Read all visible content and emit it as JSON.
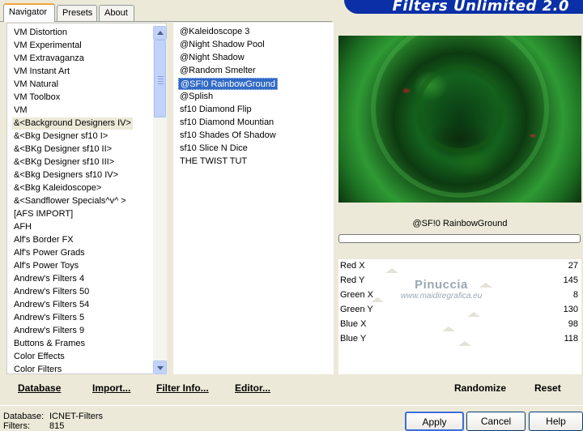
{
  "tabs": [
    {
      "label": "Navigator"
    },
    {
      "label": "Presets"
    },
    {
      "label": "About"
    }
  ],
  "banner": {
    "title": "Filters Unlimited 2.0"
  },
  "category_list": {
    "items": [
      "VM Distortion",
      "VM Experimental",
      "VM Extravaganza",
      "VM Instant Art",
      "VM Natural",
      "VM Toolbox",
      "VM",
      "&<Background Designers IV>",
      "&<Bkg Designer sf10 I>",
      "&<BKg Designer sf10 II>",
      "&<BKg Designer sf10 III>",
      "&<Bkg Designers sf10 IV>",
      "&<Bkg Kaleidoscope>",
      "&<Sandflower Specials^v^ >",
      "[AFS IMPORT]",
      "AFH",
      "Alf's Border FX",
      "Alf's Power Grads",
      "Alf's Power Toys",
      "Andrew's Filters 4",
      "Andrew's Filters 50",
      "Andrew's Filters 54",
      "Andrew's Filters 5",
      "Andrew's Filters 9",
      "Buttons & Frames",
      "Color Effects",
      "Color Filters"
    ],
    "selected": "&<Background Designers IV>"
  },
  "filter_list": {
    "items": [
      "@Kaleidoscope 3",
      "@Night Shadow Pool",
      "@Night Shadow",
      "@Random Smelter",
      "@SF!0 RainbowGround",
      "@Splish",
      "sf10 Diamond Flip",
      "sf10 Diamond Mountian",
      "sf10 Shades Of Shadow",
      "sf10 Slice N Dice",
      "THE TWIST TUT"
    ],
    "selected": "@SF!0 RainbowGround"
  },
  "preview": {
    "filter_name": "@SF!0 RainbowGround"
  },
  "params": [
    {
      "label": "Red X",
      "value": "27",
      "level": 27
    },
    {
      "label": "Red Y",
      "value": "145",
      "level": 145
    },
    {
      "label": "Green X",
      "value": "8",
      "level": 8
    },
    {
      "label": "Green Y",
      "value": "130",
      "level": 130
    },
    {
      "label": "Blue X",
      "value": "98",
      "level": 98
    },
    {
      "label": "Blue Y",
      "value": "118",
      "level": 118
    }
  ],
  "watermark": {
    "line1": "Pinuccia",
    "line2": "www.maidiregrafica.eu"
  },
  "bottom_links": {
    "database": "Database",
    "import": "Import...",
    "filter_info": "Filter Info...",
    "editor": "Editor...",
    "randomize": "Randomize",
    "reset": "Reset"
  },
  "status": {
    "database_label": "Database:",
    "database_value": "ICNET-Filters",
    "filters_label": "Filters:",
    "filters_value": "815"
  },
  "buttons": {
    "apply": "Apply",
    "cancel": "Cancel",
    "help": "Help"
  },
  "colors": {
    "accent": "#316ac5",
    "banner": "#0a2fa6",
    "tab_highlight": "#f1a43a"
  }
}
